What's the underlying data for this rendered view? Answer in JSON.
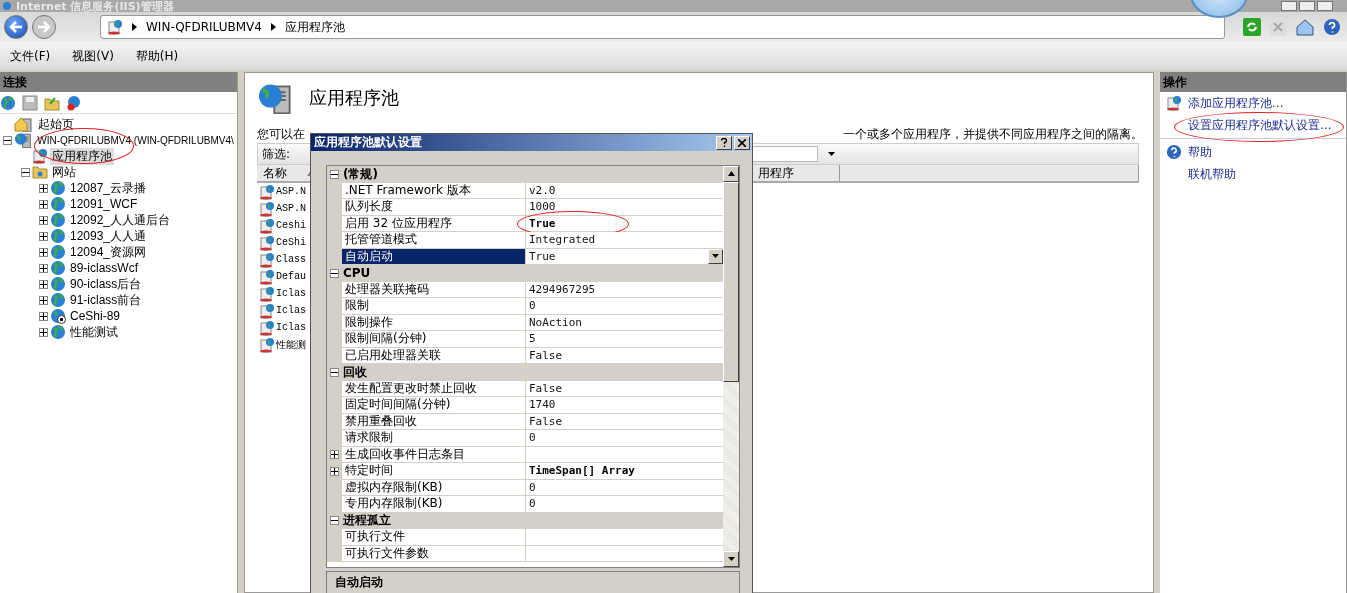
{
  "window": {
    "title": "Internet 信息服务(IIS)管理器"
  },
  "address": {
    "segments": [
      "WIN-QFDRILUBMV4",
      "应用程序池"
    ]
  },
  "menu": [
    "文件(F)",
    "视图(V)",
    "帮助(H)"
  ],
  "connections": {
    "title": "连接",
    "tree": [
      {
        "label": "起始页",
        "kind": "start",
        "selected": false,
        "circled": false
      },
      {
        "label": "WIN-QFDRILUBMV4 (WIN-QFDRILUBMV4\\",
        "kind": "server",
        "selected": false,
        "circled": false,
        "expanded": true,
        "children": [
          {
            "label": "应用程序池",
            "kind": "pool",
            "selected": true,
            "circled": true
          },
          {
            "label": "网站",
            "kind": "sites",
            "selected": false,
            "circled": false,
            "expanded": true,
            "children": [
              {
                "label": "12087_云录播",
                "kind": "site",
                "running": true,
                "selected": false,
                "circled": false,
                "expanded": false
              },
              {
                "label": "12091_WCF",
                "kind": "site",
                "running": true,
                "selected": false,
                "circled": false,
                "expanded": false
              },
              {
                "label": "12092_人人通后台",
                "kind": "site",
                "running": true,
                "selected": false,
                "circled": false,
                "expanded": false
              },
              {
                "label": "12093_人人通",
                "kind": "site",
                "running": true,
                "selected": false,
                "circled": false,
                "expanded": false
              },
              {
                "label": "12094_资源网",
                "kind": "site",
                "running": true,
                "selected": false,
                "circled": false,
                "expanded": false
              },
              {
                "label": "89-iclassWcf",
                "kind": "site",
                "running": true,
                "selected": false,
                "circled": false,
                "expanded": false
              },
              {
                "label": "90-iclass后台",
                "kind": "site",
                "running": true,
                "selected": false,
                "circled": false,
                "expanded": false
              },
              {
                "label": "91-iclass前台",
                "kind": "site",
                "running": true,
                "selected": false,
                "circled": false,
                "expanded": false
              },
              {
                "label": "CeShi-89",
                "kind": "site",
                "running": false,
                "selected": false,
                "circled": false,
                "expanded": false
              },
              {
                "label": "性能测试",
                "kind": "site",
                "running": true,
                "selected": false,
                "circled": false,
                "expanded": false
              }
            ]
          }
        ]
      }
    ]
  },
  "content": {
    "title": "应用程序池",
    "description_start": "您可以在",
    "description_end": "一个或多个应用程序，并提供不同应用程序之间的隔离。",
    "filter_label": "筛选:",
    "columns": [
      {
        "label": "名称",
        "sorted": true
      },
      {
        "label": "用程序",
        "sorted": false
      }
    ],
    "rows": [
      {
        "name": "ASP.N"
      },
      {
        "name": "ASP.N"
      },
      {
        "name": "Ceshi"
      },
      {
        "name": "CeShi"
      },
      {
        "name": "Class"
      },
      {
        "name": "Defau"
      },
      {
        "name": "Iclas"
      },
      {
        "name": "Iclas"
      },
      {
        "name": "Iclas"
      },
      {
        "name": "性能测"
      }
    ]
  },
  "actions": {
    "title": "操作",
    "groups": [
      [
        {
          "label": "添加应用程序池...",
          "kind": "add",
          "circled": false
        },
        {
          "label": "设置应用程序池默认设置...",
          "kind": "plain",
          "circled": true
        }
      ],
      [
        {
          "label": "帮助",
          "kind": "help",
          "circled": false
        },
        {
          "label": "联机帮助",
          "kind": "plain",
          "circled": false
        }
      ]
    ]
  },
  "dialog": {
    "title": "应用程序池默认设置",
    "description_title": "自动启动",
    "categories": [
      {
        "name": "(常规)",
        "expanded": true,
        "properties": [
          {
            "name": ".NET Framework 版本",
            "value": "v2.0",
            "kind": "plain",
            "modified": false,
            "selected": false,
            "circled": false
          },
          {
            "name": "队列长度",
            "value": "1000",
            "kind": "plain",
            "modified": false,
            "selected": false,
            "circled": false
          },
          {
            "name": "启用 32 位应用程序",
            "value": "True",
            "kind": "plain",
            "modified": true,
            "selected": false,
            "circled": true
          },
          {
            "name": "托管管道模式",
            "value": "Integrated",
            "kind": "plain",
            "modified": false,
            "selected": false,
            "circled": false
          },
          {
            "name": "自动启动",
            "value": "True",
            "kind": "plain",
            "modified": false,
            "selected": true,
            "circled": false
          }
        ]
      },
      {
        "name": "CPU",
        "expanded": true,
        "properties": [
          {
            "name": "处理器关联掩码",
            "value": "4294967295",
            "kind": "plain",
            "modified": false,
            "selected": false,
            "circled": false
          },
          {
            "name": "限制",
            "value": "0",
            "kind": "plain",
            "modified": false,
            "selected": false,
            "circled": false
          },
          {
            "name": "限制操作",
            "value": "NoAction",
            "kind": "plain",
            "modified": false,
            "selected": false,
            "circled": false
          },
          {
            "name": "限制间隔(分钟)",
            "value": "5",
            "kind": "plain",
            "modified": false,
            "selected": false,
            "circled": false
          },
          {
            "name": "已启用处理器关联",
            "value": "False",
            "kind": "plain",
            "modified": false,
            "selected": false,
            "circled": false
          }
        ]
      },
      {
        "name": "回收",
        "expanded": true,
        "properties": [
          {
            "name": "发生配置更改时禁止回收",
            "value": "False",
            "kind": "plain",
            "modified": false,
            "selected": false,
            "circled": false
          },
          {
            "name": "固定时间间隔(分钟)",
            "value": "1740",
            "kind": "plain",
            "modified": false,
            "selected": false,
            "circled": false
          },
          {
            "name": "禁用重叠回收",
            "value": "False",
            "kind": "plain",
            "modified": false,
            "selected": false,
            "circled": false
          },
          {
            "name": "请求限制",
            "value": "0",
            "kind": "plain",
            "modified": false,
            "selected": false,
            "circled": false
          },
          {
            "name": "生成回收事件日志条目",
            "kind": "collection",
            "selected": false,
            "circled": false
          },
          {
            "name": "特定时间",
            "value": "TimeSpan[] Array",
            "kind": "collection",
            "modified": true,
            "selected": false,
            "circled": false
          },
          {
            "name": "虚拟内存限制(KB)",
            "value": "0",
            "kind": "plain",
            "modified": false,
            "selected": false,
            "circled": false
          },
          {
            "name": "专用内存限制(KB)",
            "value": "0",
            "kind": "plain",
            "modified": false,
            "selected": false,
            "circled": false
          }
        ]
      },
      {
        "name": "进程孤立",
        "expanded": true,
        "properties": [
          {
            "name": "可执行文件",
            "kind": "plain",
            "selected": false,
            "circled": false
          },
          {
            "name": "可执行文件参数",
            "kind": "plain",
            "selected": false,
            "circled": false
          }
        ]
      }
    ]
  }
}
